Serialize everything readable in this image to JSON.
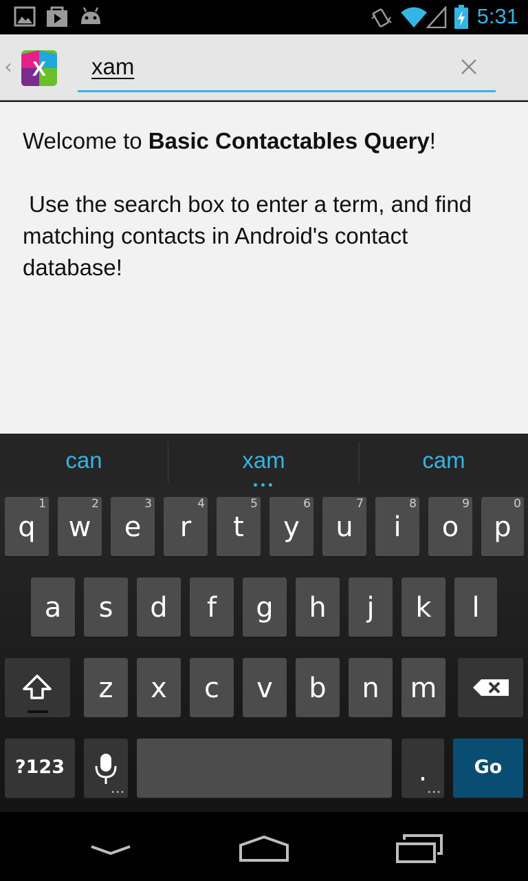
{
  "status_bar": {
    "time": "5:31",
    "icons": [
      "gallery-icon",
      "play-store-icon",
      "android-icon",
      "vibrate-icon",
      "wifi-icon",
      "signal-icon",
      "battery-charging-icon"
    ]
  },
  "action_bar": {
    "up_icon": "chevron-left-icon",
    "logo_letter": "X",
    "search_value": "xam",
    "clear_icon": "close-icon"
  },
  "content": {
    "welcome_prefix": "Welcome to ",
    "welcome_bold": "Basic Contactables Query",
    "welcome_suffix": "!",
    "instructions": " Use the search box to enter a term, and find matching contacts in Android's contact database!"
  },
  "keyboard": {
    "suggestions": [
      "can",
      "xam",
      "cam"
    ],
    "row1": [
      {
        "key": "q",
        "hint": "1"
      },
      {
        "key": "w",
        "hint": "2"
      },
      {
        "key": "e",
        "hint": "3"
      },
      {
        "key": "r",
        "hint": "4"
      },
      {
        "key": "t",
        "hint": "5"
      },
      {
        "key": "y",
        "hint": "6"
      },
      {
        "key": "u",
        "hint": "7"
      },
      {
        "key": "i",
        "hint": "8"
      },
      {
        "key": "o",
        "hint": "9"
      },
      {
        "key": "p",
        "hint": "0"
      }
    ],
    "row2": [
      "a",
      "s",
      "d",
      "f",
      "g",
      "h",
      "j",
      "k",
      "l"
    ],
    "row3": [
      "z",
      "x",
      "c",
      "v",
      "b",
      "n",
      "m"
    ],
    "symbols_label": "?123",
    "period_label": ".",
    "go_label": "Go"
  },
  "colors": {
    "accent": "#33b5e5",
    "key": "#4c4c4c",
    "go_key": "#0a4d73"
  }
}
